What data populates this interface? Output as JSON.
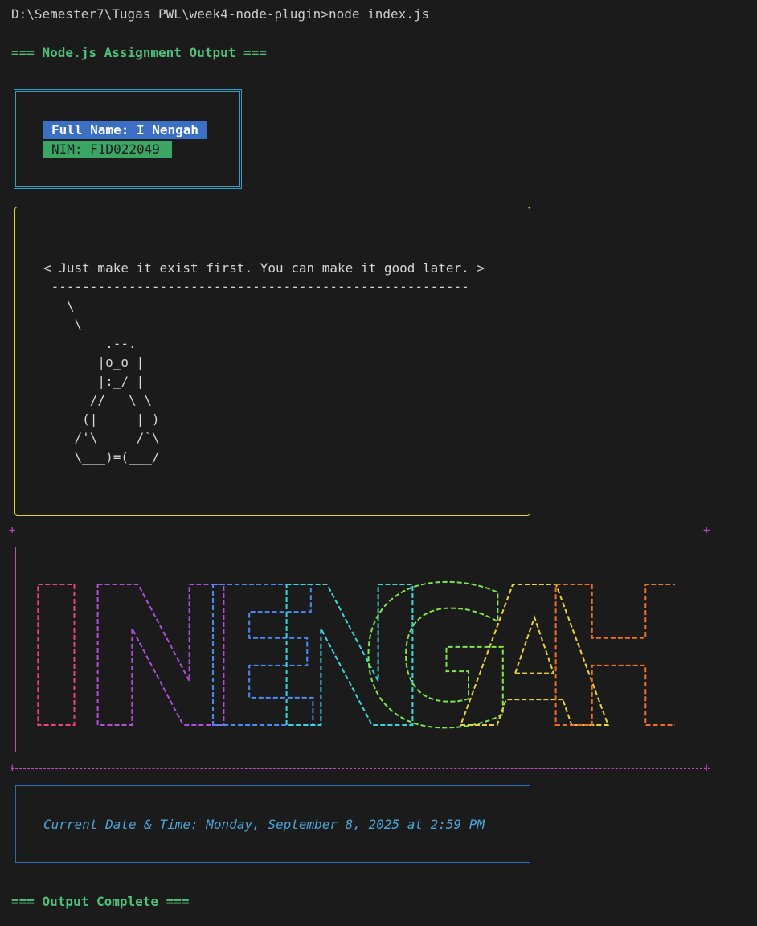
{
  "terminal": {
    "prompt_line": "D:\\Semester7\\Tugas PWL\\week4-node-plugin>node index.js",
    "header": "=== Node.js Assignment Output ===",
    "footer": "=== Output Complete ==="
  },
  "identity": {
    "full_name": "Full Name: I Nengah",
    "nim": "NIM: F1D022049"
  },
  "cowsay": {
    "art": " ______________________________________________________\n< Just make it exist first. You can make it good later. >\n ------------------------------------------------------\n   \\\n    \\\n        .--.\n       |o_o |\n       |:_/ |\n      //   \\ \\\n     (|     | )\n    /'\\_   _/`\\\n    \\___)=(___/"
  },
  "banner": {
    "letters": [
      "I",
      "N",
      "E",
      "N",
      "G",
      "A",
      "H"
    ],
    "colors": [
      "#e8467a",
      "#b14fd8",
      "#4a8cf2",
      "#3ad6e0",
      "#7ee84a",
      "#e8d43a",
      "#f0702a"
    ],
    "frame_color": "#c24ac2"
  },
  "datetime": {
    "text": "Current Date & Time: Monday, September 8, 2025 at 2:59 PM"
  }
}
